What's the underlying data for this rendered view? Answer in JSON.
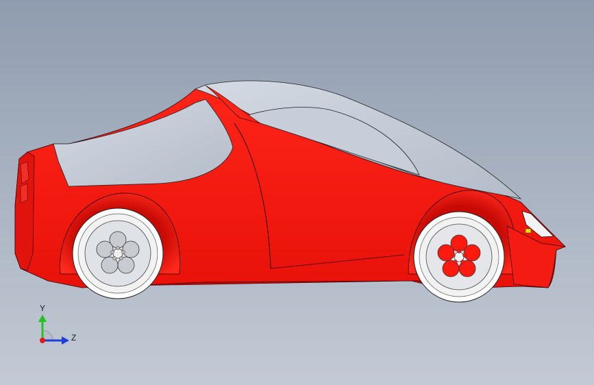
{
  "viewport": {
    "background_top": "#8f9caf",
    "background_bottom": "#c3cad5"
  },
  "model": {
    "body_color": "#ff1a10",
    "body_shadow": "#d80e08",
    "glass_color": "#c3cbd6",
    "rim_color": "#f4f4f4",
    "rear_hub_color": "#c8ccd2",
    "front_hub_color": "#ff1a10",
    "marker_color": "#e8e000"
  },
  "triad": {
    "y_label": "Y",
    "z_label": "Z",
    "y_color": "#22c422",
    "z_color": "#1d3fd8",
    "x_color": "#e01818"
  }
}
